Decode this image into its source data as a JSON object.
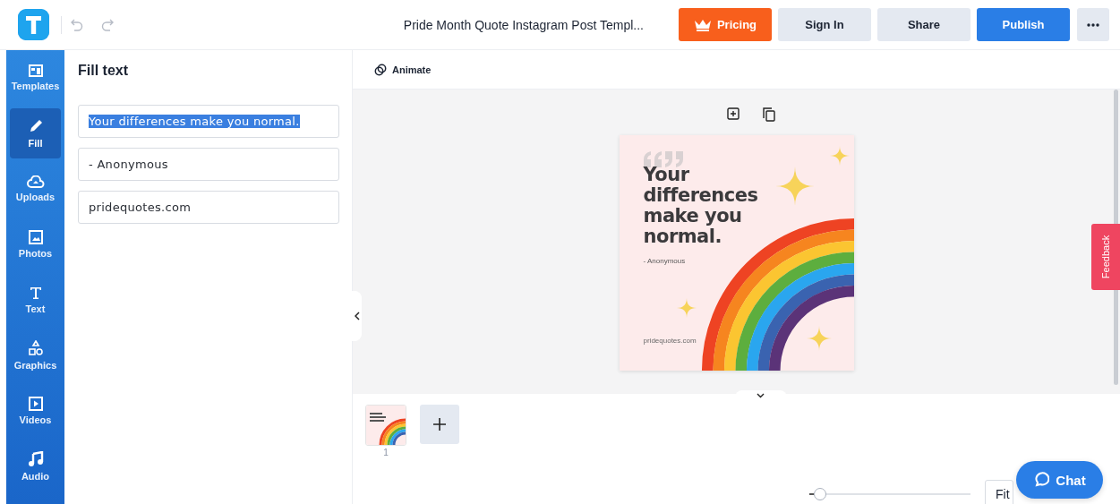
{
  "topbar": {
    "title": "Pride Month Quote Instagram Post Templ...",
    "buttons": [
      {
        "kind": "pricing",
        "label": "Pricing"
      },
      {
        "kind": "plain",
        "label": "Sign In"
      },
      {
        "kind": "plain",
        "label": "Share"
      },
      {
        "kind": "primary",
        "label": "Publish"
      }
    ]
  },
  "sidebar": {
    "items": [
      {
        "kind": "templates",
        "label": "Templates",
        "selected": false
      },
      {
        "kind": "fill",
        "label": "Fill",
        "selected": true
      },
      {
        "kind": "uploads",
        "label": "Uploads",
        "selected": false
      },
      {
        "kind": "photos",
        "label": "Photos",
        "selected": false
      },
      {
        "kind": "text",
        "label": "Text",
        "selected": false
      },
      {
        "kind": "graphics",
        "label": "Graphics",
        "selected": false
      },
      {
        "kind": "videos",
        "label": "Videos",
        "selected": false
      },
      {
        "kind": "audio",
        "label": "Audio",
        "selected": false
      }
    ]
  },
  "panel": {
    "title": "Fill text",
    "fields": [
      {
        "value": "Your differences make you normal.",
        "text_selected": true
      },
      {
        "value": "- Anonymous",
        "text_selected": false
      },
      {
        "value": "pridequotes.com",
        "text_selected": false
      }
    ]
  },
  "toolbar": {
    "animate": "Animate"
  },
  "design": {
    "quote": "Your differences make you normal.",
    "author": "- Anonymous",
    "website": "pridequotes.com"
  },
  "pages": [
    {
      "number": "1"
    }
  ],
  "zoom": {
    "level": 0.03,
    "fit": "Fit"
  },
  "chat": {
    "label": "Chat"
  },
  "feedback": {
    "label": "Feedback"
  }
}
